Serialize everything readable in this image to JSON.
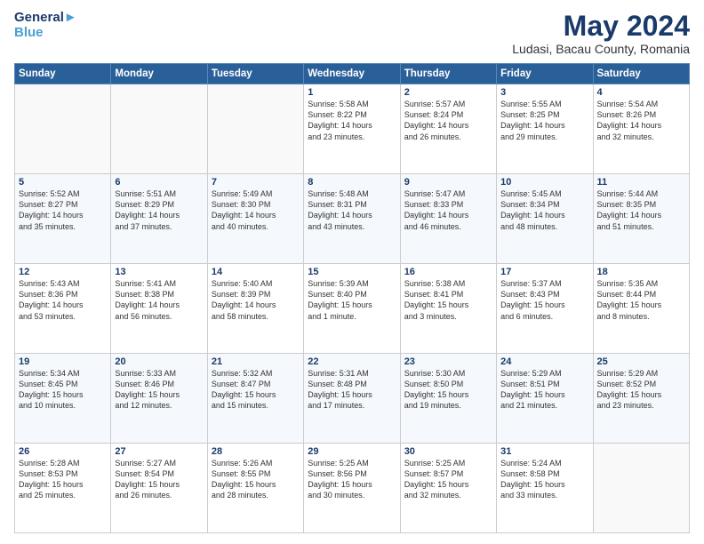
{
  "logo": {
    "line1": "General",
    "line2": "Blue"
  },
  "title": "May 2024",
  "subtitle": "Ludasi, Bacau County, Romania",
  "headers": [
    "Sunday",
    "Monday",
    "Tuesday",
    "Wednesday",
    "Thursday",
    "Friday",
    "Saturday"
  ],
  "weeks": [
    [
      {
        "day": "",
        "info": ""
      },
      {
        "day": "",
        "info": ""
      },
      {
        "day": "",
        "info": ""
      },
      {
        "day": "1",
        "info": "Sunrise: 5:58 AM\nSunset: 8:22 PM\nDaylight: 14 hours\nand 23 minutes."
      },
      {
        "day": "2",
        "info": "Sunrise: 5:57 AM\nSunset: 8:24 PM\nDaylight: 14 hours\nand 26 minutes."
      },
      {
        "day": "3",
        "info": "Sunrise: 5:55 AM\nSunset: 8:25 PM\nDaylight: 14 hours\nand 29 minutes."
      },
      {
        "day": "4",
        "info": "Sunrise: 5:54 AM\nSunset: 8:26 PM\nDaylight: 14 hours\nand 32 minutes."
      }
    ],
    [
      {
        "day": "5",
        "info": "Sunrise: 5:52 AM\nSunset: 8:27 PM\nDaylight: 14 hours\nand 35 minutes."
      },
      {
        "day": "6",
        "info": "Sunrise: 5:51 AM\nSunset: 8:29 PM\nDaylight: 14 hours\nand 37 minutes."
      },
      {
        "day": "7",
        "info": "Sunrise: 5:49 AM\nSunset: 8:30 PM\nDaylight: 14 hours\nand 40 minutes."
      },
      {
        "day": "8",
        "info": "Sunrise: 5:48 AM\nSunset: 8:31 PM\nDaylight: 14 hours\nand 43 minutes."
      },
      {
        "day": "9",
        "info": "Sunrise: 5:47 AM\nSunset: 8:33 PM\nDaylight: 14 hours\nand 46 minutes."
      },
      {
        "day": "10",
        "info": "Sunrise: 5:45 AM\nSunset: 8:34 PM\nDaylight: 14 hours\nand 48 minutes."
      },
      {
        "day": "11",
        "info": "Sunrise: 5:44 AM\nSunset: 8:35 PM\nDaylight: 14 hours\nand 51 minutes."
      }
    ],
    [
      {
        "day": "12",
        "info": "Sunrise: 5:43 AM\nSunset: 8:36 PM\nDaylight: 14 hours\nand 53 minutes."
      },
      {
        "day": "13",
        "info": "Sunrise: 5:41 AM\nSunset: 8:38 PM\nDaylight: 14 hours\nand 56 minutes."
      },
      {
        "day": "14",
        "info": "Sunrise: 5:40 AM\nSunset: 8:39 PM\nDaylight: 14 hours\nand 58 minutes."
      },
      {
        "day": "15",
        "info": "Sunrise: 5:39 AM\nSunset: 8:40 PM\nDaylight: 15 hours\nand 1 minute."
      },
      {
        "day": "16",
        "info": "Sunrise: 5:38 AM\nSunset: 8:41 PM\nDaylight: 15 hours\nand 3 minutes."
      },
      {
        "day": "17",
        "info": "Sunrise: 5:37 AM\nSunset: 8:43 PM\nDaylight: 15 hours\nand 6 minutes."
      },
      {
        "day": "18",
        "info": "Sunrise: 5:35 AM\nSunset: 8:44 PM\nDaylight: 15 hours\nand 8 minutes."
      }
    ],
    [
      {
        "day": "19",
        "info": "Sunrise: 5:34 AM\nSunset: 8:45 PM\nDaylight: 15 hours\nand 10 minutes."
      },
      {
        "day": "20",
        "info": "Sunrise: 5:33 AM\nSunset: 8:46 PM\nDaylight: 15 hours\nand 12 minutes."
      },
      {
        "day": "21",
        "info": "Sunrise: 5:32 AM\nSunset: 8:47 PM\nDaylight: 15 hours\nand 15 minutes."
      },
      {
        "day": "22",
        "info": "Sunrise: 5:31 AM\nSunset: 8:48 PM\nDaylight: 15 hours\nand 17 minutes."
      },
      {
        "day": "23",
        "info": "Sunrise: 5:30 AM\nSunset: 8:50 PM\nDaylight: 15 hours\nand 19 minutes."
      },
      {
        "day": "24",
        "info": "Sunrise: 5:29 AM\nSunset: 8:51 PM\nDaylight: 15 hours\nand 21 minutes."
      },
      {
        "day": "25",
        "info": "Sunrise: 5:29 AM\nSunset: 8:52 PM\nDaylight: 15 hours\nand 23 minutes."
      }
    ],
    [
      {
        "day": "26",
        "info": "Sunrise: 5:28 AM\nSunset: 8:53 PM\nDaylight: 15 hours\nand 25 minutes."
      },
      {
        "day": "27",
        "info": "Sunrise: 5:27 AM\nSunset: 8:54 PM\nDaylight: 15 hours\nand 26 minutes."
      },
      {
        "day": "28",
        "info": "Sunrise: 5:26 AM\nSunset: 8:55 PM\nDaylight: 15 hours\nand 28 minutes."
      },
      {
        "day": "29",
        "info": "Sunrise: 5:25 AM\nSunset: 8:56 PM\nDaylight: 15 hours\nand 30 minutes."
      },
      {
        "day": "30",
        "info": "Sunrise: 5:25 AM\nSunset: 8:57 PM\nDaylight: 15 hours\nand 32 minutes."
      },
      {
        "day": "31",
        "info": "Sunrise: 5:24 AM\nSunset: 8:58 PM\nDaylight: 15 hours\nand 33 minutes."
      },
      {
        "day": "",
        "info": ""
      }
    ]
  ]
}
